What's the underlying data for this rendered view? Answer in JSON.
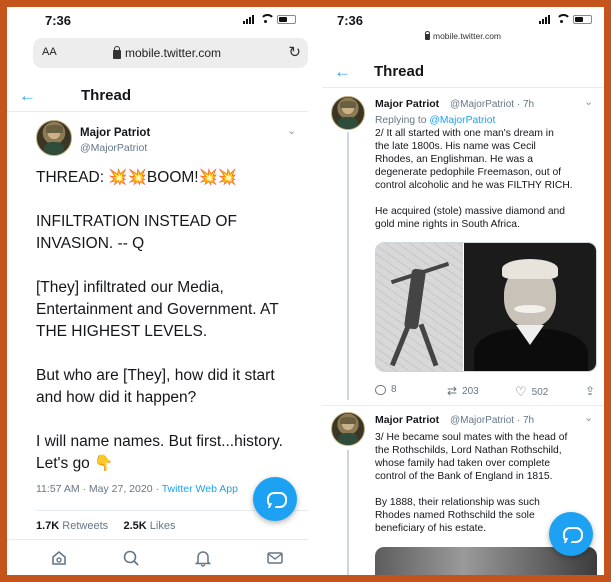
{
  "left": {
    "status_time": "7:36",
    "url_aa": "AA",
    "url": "mobile.twitter.com",
    "header_title": "Thread",
    "author_name": "Major Patriot",
    "author_handle": "@MajorPatriot",
    "tweet_lines": [
      "THREAD:  💥💥BOOM!💥💥",
      "INFILTRATION INSTEAD OF",
      "INVASION. -- Q",
      "[They] infiltrated our Media,",
      "Entertainment and Government.  AT",
      "THE HIGHEST LEVELS.",
      "But who are [They], how did it start",
      "and how did it happen?",
      "I will name names. But first...history.",
      "Let's go 👇"
    ],
    "timestamp": "11:57 AM · May 27, 2020 · ",
    "source": "Twitter Web App",
    "retweets_count": "1.7K",
    "retweets_label": " Retweets",
    "likes_count": "2.5K",
    "likes_label": " Likes"
  },
  "right": {
    "status_time": "7:36",
    "url": "mobile.twitter.com",
    "header_title": "Thread",
    "tweet1": {
      "author_name": "Major Patriot",
      "author_handle": "@MajorPatriot · 7h",
      "replying_prefix": "Replying to ",
      "replying_handle": "@MajorPatriot",
      "lines": [
        "2/ It all started with one man's dream in",
        "the late 1800s.  His name was Cecil",
        "Rhodes, an Englishman.  He was a",
        "degenerate pedophile Freemason, out of",
        "control alcoholic and he was FILTHY RICH."
      ],
      "lines2": [
        "He acquired (stole) massive diamond and",
        "gold mine rights in South Africa."
      ],
      "replies": "8",
      "retweets": "203",
      "likes": "502"
    },
    "tweet2": {
      "author_name": "Major Patriot",
      "author_handle": "@MajorPatriot · 7h",
      "lines": [
        "3/ He became soul mates with the head of",
        "the Rothschilds, Lord Nathan Rothschild,",
        "whose family had taken over complete",
        "control of the Bank of England in 1815."
      ],
      "lines2": [
        "By 1888, their relationship was such",
        "Rhodes named Rothschild the sole",
        "beneficiary of his estate."
      ]
    }
  },
  "colors": {
    "frame_border": "#c4541c",
    "twitter_blue": "#1da1f2",
    "muted": "#657786"
  },
  "icons": [
    "back-arrow-icon",
    "lock-icon",
    "reload-icon",
    "chevron-down-icon",
    "compose-icon",
    "home-icon",
    "search-icon",
    "bell-icon",
    "mail-icon",
    "reply-icon",
    "retweet-icon",
    "like-icon",
    "share-icon"
  ]
}
